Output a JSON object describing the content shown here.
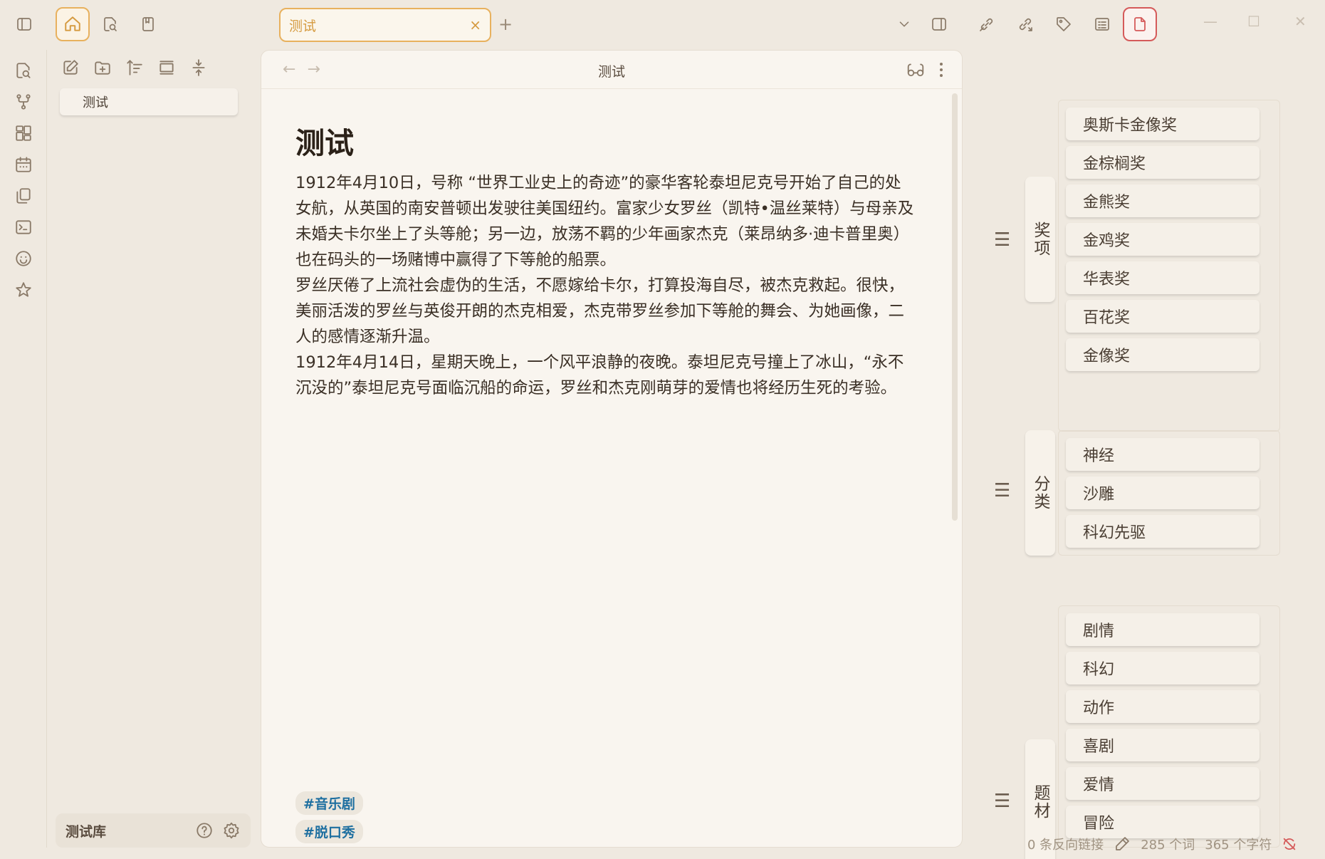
{
  "tab": {
    "title": "测试",
    "close": "×",
    "add": "+"
  },
  "window": {
    "minimize": "—",
    "maximize": "☐",
    "close": "✕"
  },
  "explorer": {
    "files": [
      "测试"
    ],
    "vault_name": "测试库"
  },
  "editor": {
    "header_title": "测试",
    "back": "←",
    "forward": "→",
    "title": "测试",
    "paragraphs": [
      "1912年4月10日，号称 “世界工业史上的奇迹”的豪华客轮泰坦尼克号开始了自己的处女航，从英国的南安普顿出发驶往美国纽约。富家少女罗丝（凯特•温丝莱特）与母亲及未婚夫卡尔坐上了头等舱；另一边，放荡不羁的少年画家杰克（莱昂纳多·迪卡普里奥）也在码头的一场赌博中赢得了下等舱的船票。",
      "罗丝厌倦了上流社会虚伪的生活，不愿嫁给卡尔，打算投海自尽，被杰克救起。很快，美丽活泼的罗丝与英俊开朗的杰克相爱，杰克带罗丝参加下等舱的舞会、为她画像，二人的感情逐渐升温。",
      "1912年4月14日，星期天晚上，一个风平浪静的夜晚。泰坦尼克号撞上了冰山，“永不沉没的”泰坦尼克号面临沉船的命运，罗丝和杰克刚萌芽的爱情也将经历生死的考验。"
    ],
    "tags": [
      "#音乐剧",
      "#脱口秀"
    ]
  },
  "panel": {
    "handle": "☰",
    "groups": [
      {
        "label": "奖项",
        "items": [
          "奥斯卡金像奖",
          "金棕榈奖",
          "金熊奖",
          "金鸡奖",
          "华表奖",
          "百花奖",
          "金像奖"
        ]
      },
      {
        "label": "分类",
        "items": [
          "神经",
          "沙雕",
          "科幻先驱"
        ]
      },
      {
        "label": "题材",
        "items": [
          "剧情",
          "科幻",
          "动作",
          "喜剧",
          "爱情",
          "冒险"
        ]
      }
    ]
  },
  "status": {
    "backlinks": "0 条反向链接",
    "words": "285 个词",
    "chars": "365 个字符"
  },
  "colors": {
    "accent": "#e8b15e",
    "active_doc": "#d55a5a",
    "tag_text": "#1e6fa0",
    "background": "#efe9e0"
  }
}
